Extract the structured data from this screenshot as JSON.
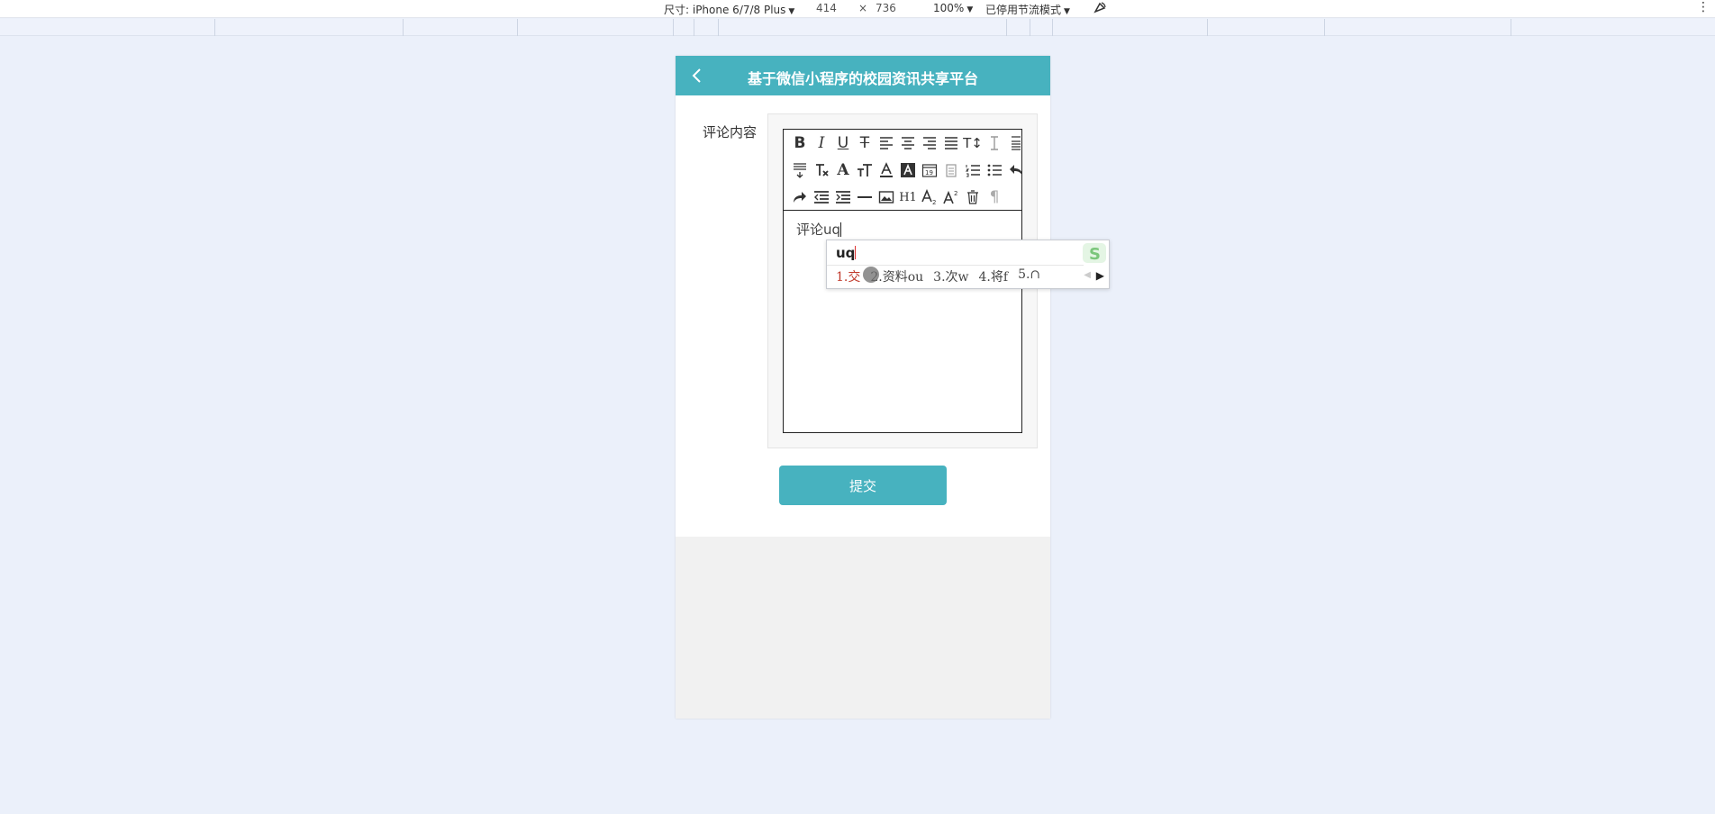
{
  "devtools": {
    "device_label": "尺寸: iPhone 6/7/8 Plus",
    "width": "414",
    "times": "×",
    "height": "736",
    "zoom": "100%",
    "throttle": "已停用节流模式",
    "menu": "⋮"
  },
  "app": {
    "title": "基于微信小程序的校园资讯共享平台",
    "back_icon": "chevron-left-icon",
    "accent": "#47b2bf"
  },
  "form": {
    "label": "评论内容",
    "editor_text": "评论uq",
    "submit_label": "提交"
  },
  "toolbar": {
    "bold": "B",
    "italic": "I",
    "underline": "U",
    "strike": "T",
    "h1": "H1",
    "fontsize": "T↕",
    "fontfamily": "A",
    "paragraph": "¶"
  },
  "ime": {
    "composition": "uq",
    "candidates": [
      "1.交",
      "2.资料ou",
      "3.次w",
      "4.将f",
      "5.∩"
    ],
    "logo": "S"
  }
}
